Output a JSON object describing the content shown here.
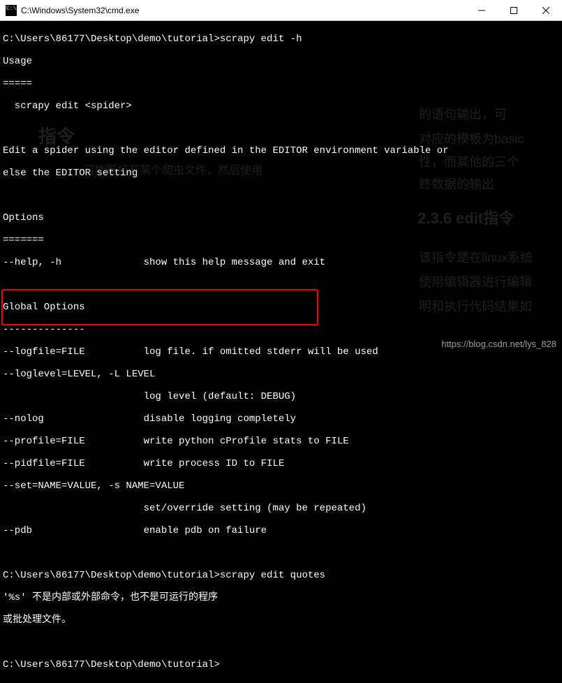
{
  "titlebar": {
    "title": "C:\\Windows\\System32\\cmd.exe"
  },
  "terminal": {
    "lines": [
      "C:\\Users\\86177\\Desktop\\demo\\tutorial>scrapy edit -h",
      "Usage",
      "=====",
      "  scrapy edit <spider>",
      "",
      "Edit a spider using the editor defined in the EDITOR environment variable or",
      "else the EDITOR setting",
      "",
      "Options",
      "=======",
      "--help, -h              show this help message and exit",
      "",
      "Global Options",
      "--------------",
      "--logfile=FILE          log file. if omitted stderr will be used",
      "--loglevel=LEVEL, -L LEVEL",
      "                        log level (default: DEBUG)",
      "--nolog                 disable logging completely",
      "--profile=FILE          write python cProfile stats to FILE",
      "--pidfile=FILE          write process ID to FILE",
      "--set=NAME=VALUE, -s NAME=VALUE",
      "                        set/override setting (may be repeated)",
      "--pdb                   enable pdb on failure",
      "",
      "C:\\Users\\86177\\Desktop\\demo\\tutorial>scrapy edit quotes",
      "'%s' 不是内部或外部命令，也不是可运行的程序",
      "或批处理文件。",
      "",
      "C:\\Users\\86177\\Desktop\\demo\\tutorial>"
    ]
  },
  "watermark": "https://blog.csdn.net/lys_828",
  "ghost_text": {
    "g1": "指令",
    "g2": "可能是打开某个爬虫文件，然后使用",
    "g3": "的语句输出，可",
    "g4": "对应的模板为basic",
    "g5": "性，而其他的三个",
    "g6": "终数据的输出",
    "g7": "2.3.6 edit指令",
    "g8": "该指令是在linux系统",
    "g9": "使用编辑器进行编辑",
    "g10": "明和执行代码结果如"
  }
}
